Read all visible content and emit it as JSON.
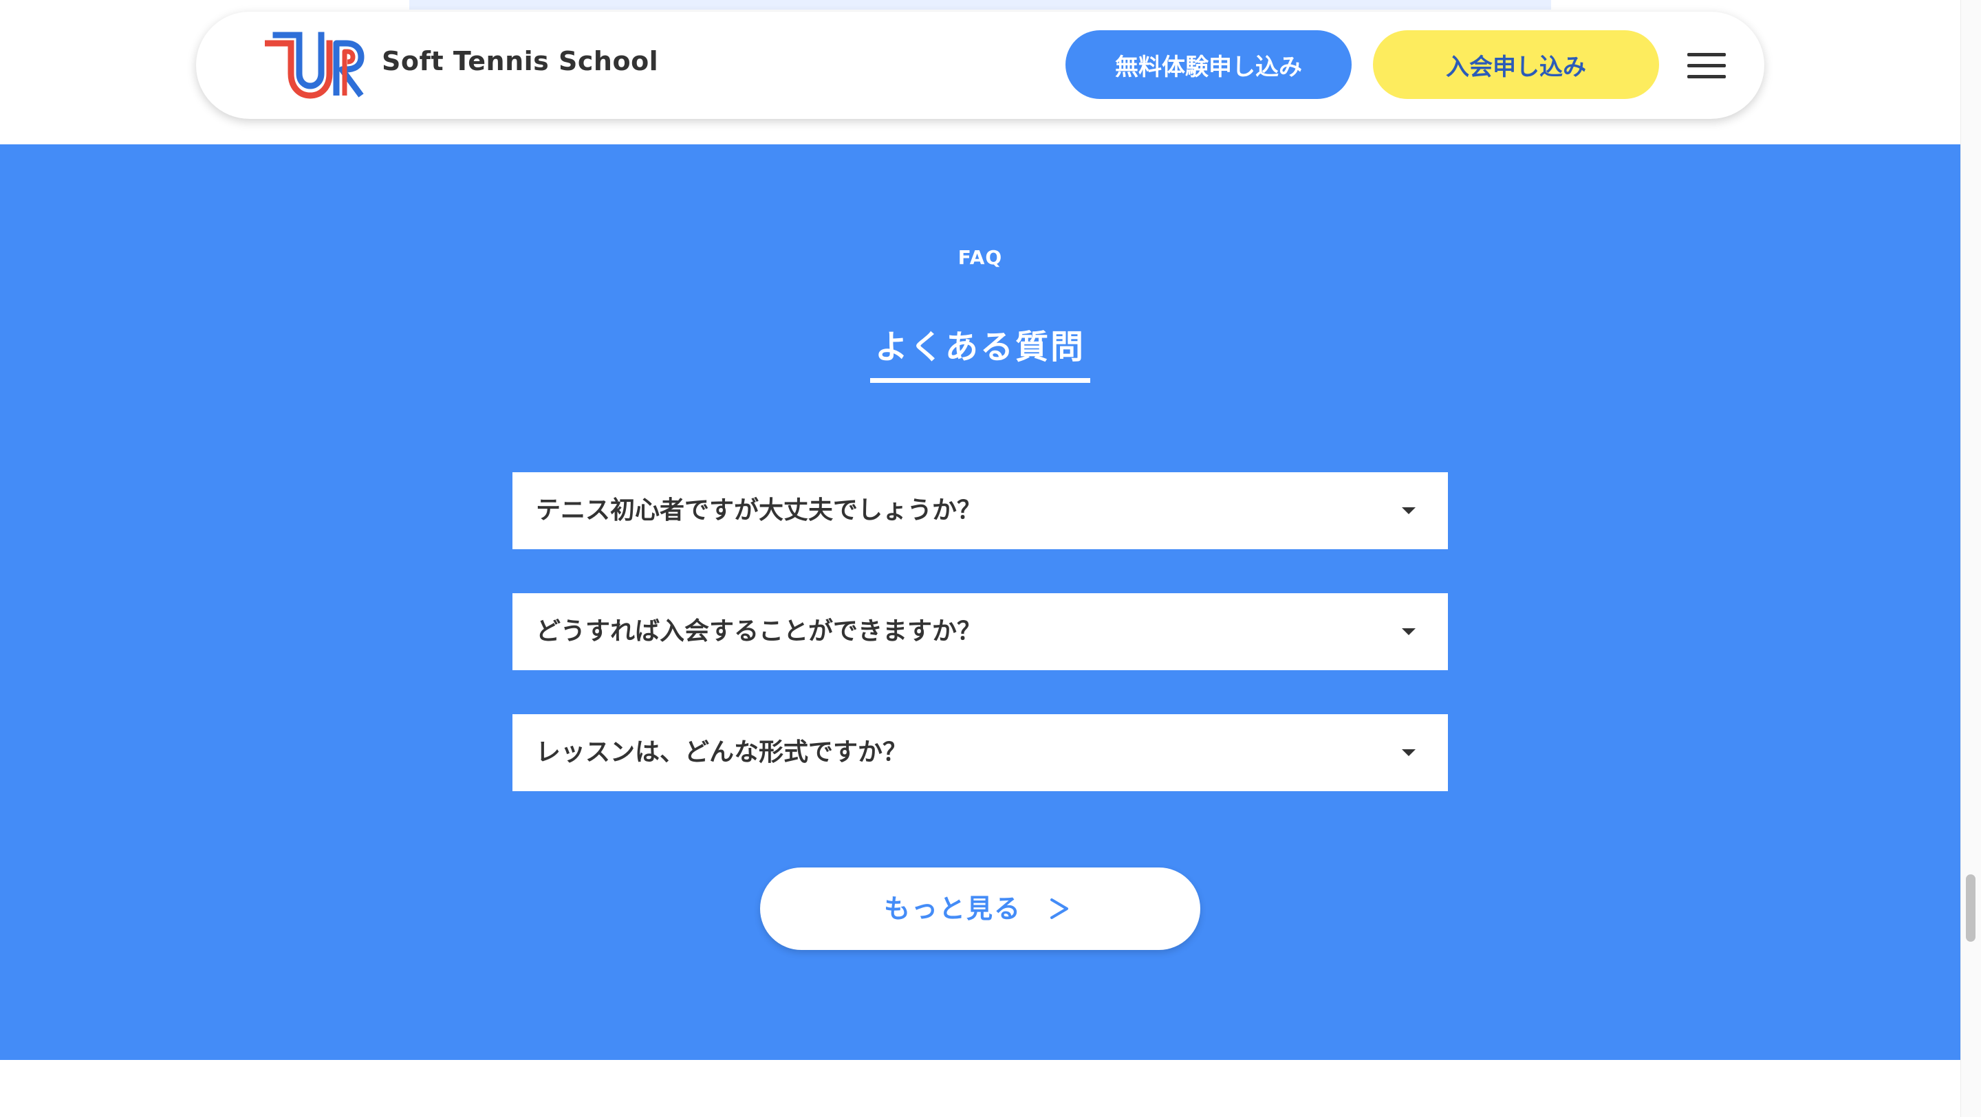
{
  "header": {
    "brand_name": "Soft Tennis School",
    "logo_text": "UR",
    "trial_button_label": "無料体験申し込み",
    "join_button_label": "入会申し込み"
  },
  "faq": {
    "eyebrow": "FAQ",
    "title": "よくある質問",
    "items": [
      {
        "question": "テニス初心者ですが大丈夫でしょうか？"
      },
      {
        "question": "どうすれば入会することができますか？"
      },
      {
        "question": "レッスンは、どんな形式ですか？"
      }
    ],
    "more_button_label": "もっと見る"
  },
  "colors": {
    "primary_blue": "#448cf7",
    "accent_yellow": "#fdec5e",
    "text_dark": "#333333",
    "logo_blue": "#2e6fd8",
    "logo_red": "#e8483a"
  },
  "icons": {
    "menu": "hamburger-menu-icon",
    "faq_toggle": "caret-down-icon",
    "more": "chevron-right-icon"
  }
}
